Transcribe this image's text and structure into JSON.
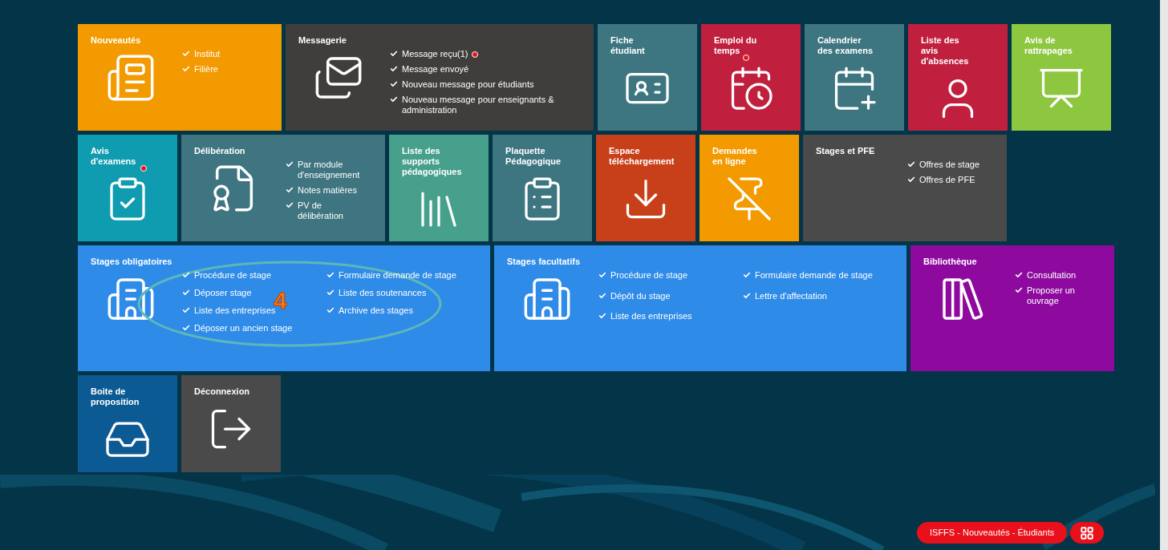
{
  "rows": [
    {
      "tiles": [
        {
          "title": [
            "Nouveautés"
          ],
          "color": "#f39a00",
          "kind": "news",
          "links": [
            {
              "text": "Institut",
              "badge": false
            },
            {
              "text": "Filière",
              "badge": false
            }
          ]
        },
        {
          "title": [
            "Messagerie"
          ],
          "color": "#3f3e3c",
          "kind": "mail",
          "links": [
            {
              "text": "Message reçu(1)",
              "badge": true
            },
            {
              "text": "Message envoyé",
              "badge": false
            },
            {
              "text": "Nouveau message pour étudiants",
              "badge": false
            },
            {
              "text": "Nouveau message pour enseignants & administration",
              "badge": false
            }
          ]
        },
        {
          "title": [
            "Fiche",
            "étudiant"
          ],
          "color": "#3d7680",
          "kind": "card"
        },
        {
          "title": [
            "Emploi du",
            "temps"
          ],
          "badge": true,
          "color": "#c0203e",
          "kind": "timetable"
        },
        {
          "title": [
            "Calendrier",
            "des examens"
          ],
          "color": "#3d7680",
          "kind": "calendar"
        },
        {
          "title": [
            "Liste des",
            "avis",
            "d'absences"
          ],
          "color": "#c0203e",
          "kind": "person"
        },
        {
          "title": [
            "Avis de",
            "rattrapages"
          ],
          "color": "#8dc63f",
          "kind": "board"
        }
      ]
    },
    {
      "tiles": [
        {
          "title": [
            "Avis",
            "d'examens"
          ],
          "badge": true,
          "color": "#0f9bb0",
          "kind": "clipboard"
        },
        {
          "title": [
            "Délibération"
          ],
          "color": "#3f7580",
          "kind": "certificate",
          "links": [
            {
              "text": "Par module d'enseignement",
              "badge": false
            },
            {
              "text": "Notes matières",
              "badge": false
            },
            {
              "text": "PV de délibération",
              "badge": false
            }
          ]
        },
        {
          "title": [
            "Liste des",
            "supports",
            "pédagogiques"
          ],
          "color": "#46a08c",
          "kind": "books"
        },
        {
          "title": [
            "Plaquette",
            "Pédagogique"
          ],
          "color": "#3d7680",
          "kind": "brochure"
        },
        {
          "title": [
            "Espace",
            "téléchargement"
          ],
          "color": "#c8401a",
          "kind": "download"
        },
        {
          "title": [
            "Demandes",
            "en ligne"
          ],
          "color": "#f39a00",
          "kind": "pin"
        },
        {
          "title": [
            "Stages et PFE"
          ],
          "color": "#4a4a4a",
          "kind": "none",
          "links": [
            {
              "text": "Offres de stage",
              "badge": false
            },
            {
              "text": "Offres de PFE",
              "badge": false
            }
          ]
        }
      ]
    },
    {
      "tiles": [
        {
          "title": [
            "Stages obligatoires"
          ],
          "color": "#2e8be8",
          "kind": "buildings",
          "annotation": {
            "label": "4"
          },
          "links": [
            {
              "text": "Procédure de stage",
              "badge": false
            },
            {
              "text": "Formulaire demande de stage",
              "badge": false
            },
            {
              "text": "Déposer stage",
              "badge": false
            },
            {
              "text": "Liste des soutenances",
              "badge": false
            },
            {
              "text": "Liste des entreprises",
              "badge": false
            },
            {
              "text": "Archive des stages",
              "badge": false
            },
            {
              "text": "Déposer un ancien stage",
              "badge": false
            }
          ]
        },
        {
          "title": [
            "Stages facultatifs"
          ],
          "color": "#2e8be8",
          "kind": "buildings",
          "links": [
            {
              "text": "Procédure de stage",
              "badge": false
            },
            {
              "text": "Formulaire demande de stage",
              "badge": false
            },
            {
              "text": "Dépôt du stage",
              "badge": false
            },
            {
              "text": "Lettre d'affectation",
              "badge": false
            },
            {
              "text": "Liste des entreprises",
              "badge": false
            }
          ]
        },
        {
          "title": [
            "Bibliothèque"
          ],
          "color": "#8e0a9e",
          "kind": "shelf",
          "links": [
            {
              "text": "Consultation",
              "badge": false
            },
            {
              "text": "Proposer un ouvrage",
              "badge": false
            }
          ]
        }
      ]
    },
    {
      "tiles": [
        {
          "title": [
            "Boite de",
            "proposition"
          ],
          "color": "#0b5a93",
          "kind": "inbox"
        },
        {
          "title": [
            "Déconnexion"
          ],
          "color": "#4a4a4a",
          "kind": "logout"
        }
      ]
    }
  ],
  "footer": {
    "label": "ISFFS - Nouveautés - Étudiants"
  }
}
